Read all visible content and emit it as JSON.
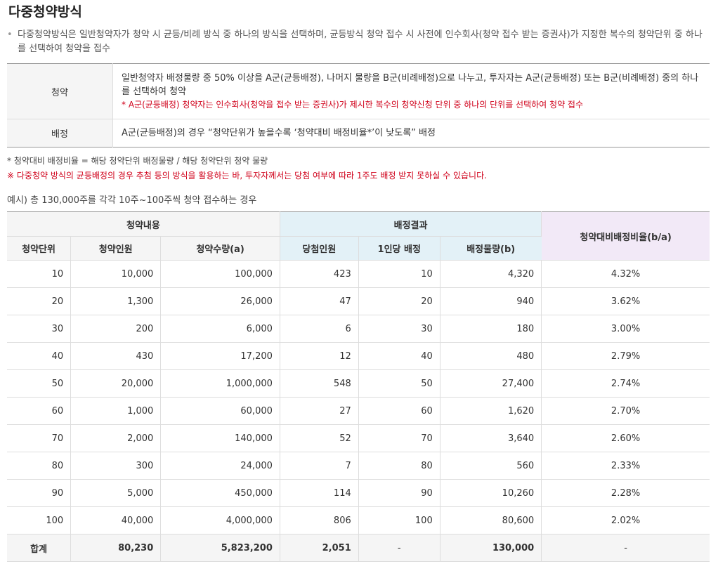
{
  "title": "다중청약방식",
  "intro": "다중청약방식은 일반청약자가 청약 시 균등/비례 방식 중 하나의 방식을 선택하며, 균등방식 청약 접수 시 사전에 인수회사(청약 접수 받는 증권사)가 지정한 복수의 청약단위 중 하나를 선택하여 청약을 접수",
  "info_table": {
    "row1_label": "청약",
    "row1_text1": "일반청약자 배정물량 중 50% 이상을 A군(균등배정), 나머지 물량을 B군(비례배정)으로 나누고, 투자자는 A군(균등배정) 또는 B군(비례배정) 중의 하나를 선택하여 청약",
    "row1_text2": "* A군(균등배정) 청약자는 인수회사(청약을 접수 받는 증권사)가 제시한 복수의 청약신청 단위 중 하나의 단위를 선택하여 청약 접수",
    "row2_label": "배정",
    "row2_text": "A군(균등배정)의 경우 “청약단위가 높을수록 ‘청약대비 배정비율*’이 낮도록” 배정"
  },
  "note1": "* 청약대비 배정비율 = 해당 청약단위 배정물량 / 해당 청약단위 청약 물량",
  "note2": "※ 다중청약 방식의 균등배정의 경우 추첨 등의 방식을 활용하는 바, 투자자께서는 당첨 여부에 따라 1주도 배정 받지 못하실 수 있습니다.",
  "example": "예시) 총 130,000주를 각각 10주~100주씩 청약  접수하는 경우",
  "data_table": {
    "group1": "청약내용",
    "group2": "배정결과",
    "group3": "청약대비배정비율(b/a)",
    "col1": "청약단위",
    "col2": "청약인원",
    "col3": "청약수량(a)",
    "col4": "당첨인원",
    "col5": "1인당 배정",
    "col6": "배정물량(b)",
    "rows": [
      [
        "10",
        "10,000",
        "100,000",
        "423",
        "10",
        "4,320",
        "4.32%"
      ],
      [
        "20",
        "1,300",
        "26,000",
        "47",
        "20",
        "940",
        "3.62%"
      ],
      [
        "30",
        "200",
        "6,000",
        "6",
        "30",
        "180",
        "3.00%"
      ],
      [
        "40",
        "430",
        "17,200",
        "12",
        "40",
        "480",
        "2.79%"
      ],
      [
        "50",
        "20,000",
        "1,000,000",
        "548",
        "50",
        "27,400",
        "2.74%"
      ],
      [
        "60",
        "1,000",
        "60,000",
        "27",
        "60",
        "1,620",
        "2.70%"
      ],
      [
        "70",
        "2,000",
        "140,000",
        "52",
        "70",
        "3,640",
        "2.60%"
      ],
      [
        "80",
        "300",
        "24,000",
        "7",
        "80",
        "560",
        "2.33%"
      ],
      [
        "90",
        "5,000",
        "450,000",
        "114",
        "90",
        "10,260",
        "2.28%"
      ],
      [
        "100",
        "40,000",
        "4,000,000",
        "806",
        "100",
        "80,600",
        "2.02%"
      ]
    ],
    "total": [
      "합계",
      "80,230",
      "5,823,200",
      "2,051",
      "-",
      "130,000",
      "-"
    ]
  }
}
